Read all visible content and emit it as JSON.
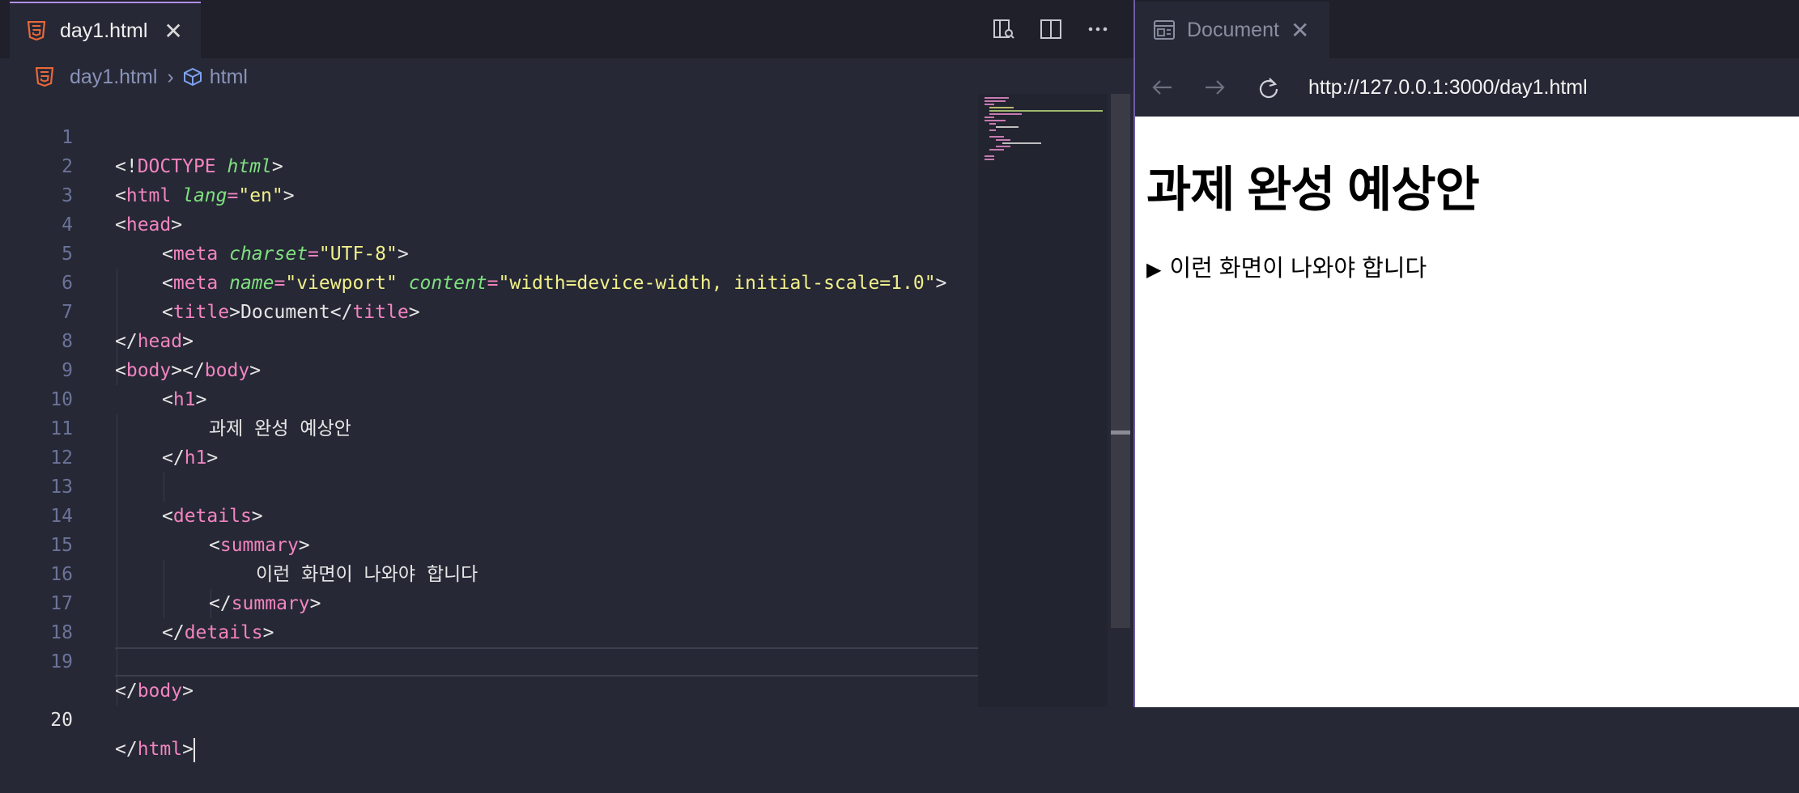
{
  "editor": {
    "tab": {
      "filename": "day1.html"
    },
    "breadcrumb": {
      "file": "day1.html",
      "node": "html"
    },
    "line_numbers": [
      "1",
      "2",
      "3",
      "4",
      "5",
      "6",
      "7",
      "8",
      "9",
      "10",
      "11",
      "12",
      "13",
      "14",
      "15",
      "16",
      "17",
      "18",
      "19",
      "20"
    ],
    "active_line": 20,
    "icons": {
      "file": "html5-icon",
      "close": "close-icon",
      "actions": [
        "open-preview-icon",
        "split-editor-icon",
        "more-actions-icon"
      ],
      "breadcrumb_node": "cube-icon"
    },
    "tokens": {
      "l1_open": "<!",
      "l1_doctype": "DOCTYPE",
      "l1_sp": " ",
      "l1_html": "html",
      "l1_close": ">",
      "l2_open": "<",
      "l2_tag": "html",
      "l2_sp": " ",
      "l2_attr": "lang",
      "l2_eq": "=",
      "l2_val": "\"en\"",
      "l2_close": ">",
      "l3_open": "<",
      "l3_tag": "head",
      "l3_close": ">",
      "l4_open": "<",
      "l4_tag": "meta",
      "l4_sp": " ",
      "l4_attr": "charset",
      "l4_eq": "=",
      "l4_val": "\"UTF-8\"",
      "l4_close": ">",
      "l5_open": "<",
      "l5_tag": "meta",
      "l5_sp1": " ",
      "l5_attr1": "name",
      "l5_eq1": "=",
      "l5_val1": "\"viewport\"",
      "l5_sp2": " ",
      "l5_attr2": "content",
      "l5_eq2": "=",
      "l5_val2": "\"width=device-width, initial-scale=1.0\"",
      "l5_close": ">",
      "l6_open": "<",
      "l6_tag": "title",
      "l6_mid1": ">",
      "l6_text": "Document",
      "l6_mid2": "</",
      "l6_tag2": "title",
      "l6_close": ">",
      "l7_open": "</",
      "l7_tag": "head",
      "l7_close": ">",
      "l8_open": "<",
      "l8_tag": "body",
      "l8_mid": "></",
      "l8_tag2": "body",
      "l8_close": ">",
      "l9_open": "<",
      "l9_tag": "h1",
      "l9_close": ">",
      "l10_text": "과제 완성 예상안",
      "l11_open": "</",
      "l11_tag": "h1",
      "l11_close": ">",
      "l13_open": "<",
      "l13_tag": "details",
      "l13_close": ">",
      "l14_open": "<",
      "l14_tag": "summary",
      "l14_close": ">",
      "l15_text": "이런 화면이 나와야 합니다",
      "l16_open": "</",
      "l16_tag": "summary",
      "l16_close": ">",
      "l17_open": "</",
      "l17_tag": "details",
      "l17_close": ">",
      "l19_open": "</",
      "l19_tag": "body",
      "l19_close": ">",
      "l20_open": "</",
      "l20_tag": "html",
      "l20_close": ">"
    }
  },
  "preview": {
    "tab_title": "Document",
    "url": "http://127.0.0.1:3000/day1.html",
    "icons": {
      "tab": "browser-preview-icon",
      "back": "back-arrow-icon",
      "forward": "forward-arrow-icon",
      "reload": "reload-icon",
      "disclosure": "disclosure-triangle-icon"
    },
    "page": {
      "heading": "과제 완성 예상안",
      "summary_marker": "▶",
      "summary": "이런 화면이 나와야 합니다"
    }
  },
  "colors": {
    "editor_bg": "#262835",
    "tabbar_bg": "#1f2029",
    "accent": "#b38ee8",
    "tag": "#f284c0",
    "attr": "#7fe07f",
    "string": "#f1f08a",
    "line_number": "#6c7399"
  }
}
